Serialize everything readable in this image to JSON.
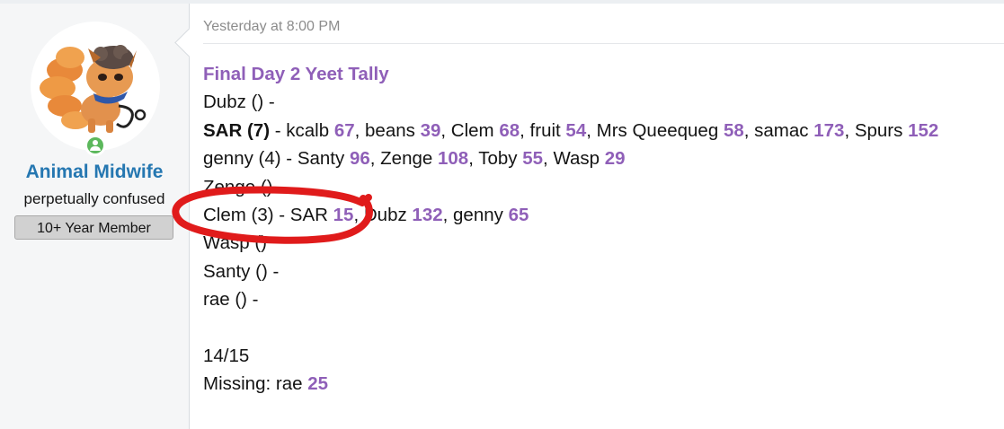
{
  "sidebar": {
    "username": "Animal Midwife",
    "user_title": "perpetually confused",
    "banner": "10+ Year Member"
  },
  "post": {
    "timestamp": "Yesterday at 8:00 PM",
    "title": "Final Day 2 Yeet Tally",
    "lines": {
      "dubz": "Dubz () -",
      "sar_head": "SAR (7)",
      "sar_p1": " - kcalb ",
      "sar_n1": "67",
      "sar_p2": ", beans ",
      "sar_n2": "39",
      "sar_p3": ", Clem ",
      "sar_n3": "68",
      "sar_p4": ", fruit ",
      "sar_n4": "54",
      "sar_p5": ", Mrs Queequeg ",
      "sar_n5": "58",
      "sar_p6": ", samac ",
      "sar_n6": "173",
      "sar_p7": ", Spurs ",
      "sar_n7": "152",
      "genny_p0": "genny (4) - Santy ",
      "genny_n1": "96",
      "genny_p1": ", Zenge ",
      "genny_n2": "108",
      "genny_p2": ", Toby ",
      "genny_n3": "55",
      "genny_p3": ", Wasp ",
      "genny_n4": "29",
      "zenge": "Zenge ()",
      "clem_p0": "Clem (3) - SAR ",
      "clem_n1": "15",
      "clem_p1": ", Dubz ",
      "clem_n2": "132",
      "clem_p2": ", genny ",
      "clem_n3": "65",
      "wasp": "Wasp ()",
      "santy": "Santy () -",
      "rae": "rae () -",
      "count": "14/15",
      "missing_label": "Missing: rae ",
      "missing_n": "25"
    }
  },
  "colors": {
    "username": "#2577b1",
    "vote_number": "#8f5fb8",
    "annotation_circle": "#e01b1b",
    "sidebar_bg": "#f5f6f7",
    "online": "#5cb85c"
  },
  "icons": {
    "avatar": "vulpix-fox-avatar-icon",
    "status": "online-user-icon"
  }
}
